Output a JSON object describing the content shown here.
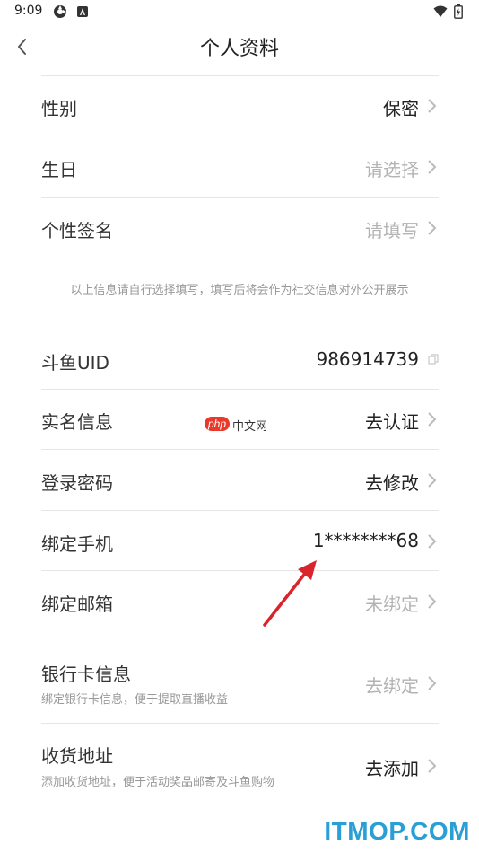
{
  "status_bar": {
    "time": "9:09"
  },
  "header": {
    "title": "个人资料"
  },
  "rows_top": [
    {
      "label": "性别",
      "value": "保密",
      "value_style": "dark"
    },
    {
      "label": "生日",
      "value": "请选择",
      "value_style": "gray"
    },
    {
      "label": "个性签名",
      "value": "请填写",
      "value_style": "gray"
    }
  ],
  "note": "以上信息请自行选择填写，填写后将会作为社交信息对外公开展示",
  "uid": {
    "label": "斗鱼UID",
    "value": "986914739"
  },
  "rows_mid": [
    {
      "label": "实名信息",
      "value": "去认证",
      "value_style": "dark"
    },
    {
      "label": "登录密码",
      "value": "去修改",
      "value_style": "dark"
    },
    {
      "label": "绑定手机",
      "value": "1********68",
      "value_style": "dark"
    },
    {
      "label": "绑定邮箱",
      "value": "未绑定",
      "value_style": "gray"
    }
  ],
  "bank": {
    "label": "银行卡信息",
    "sub": "绑定银行卡信息，便于提取直播收益",
    "value": "去绑定"
  },
  "address": {
    "label": "收货地址",
    "sub": "添加收货地址，便于活动奖品邮寄及斗鱼购物",
    "value": "去添加"
  },
  "watermark_php": {
    "php": "php",
    "cn": "中文网"
  },
  "watermark_itmop": "ITMOP.COM",
  "colors": {
    "arrow": "#d9242b",
    "itmop": "#2a9fd6",
    "php_red": "#e8392b"
  }
}
